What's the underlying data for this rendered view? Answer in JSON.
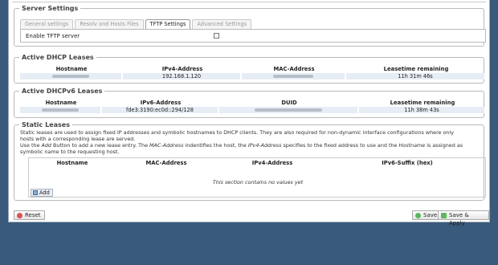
{
  "server_settings": {
    "legend": "Server Settings",
    "tabs": [
      "General settings",
      "Resolv and Hosts Files",
      "TFTP Settings",
      "Advanced Settings"
    ],
    "active_tab": "TFTP Settings",
    "enable_tftp_label": "Enable TFTP server",
    "enable_tftp_checked": false
  },
  "dhcp_leases": {
    "legend": "Active DHCP Leases",
    "headers": [
      "Hostname",
      "IPv4-Address",
      "MAC-Address",
      "Leasetime remaining"
    ],
    "row": {
      "ipv4": "192.168.1.120",
      "lease": "11h 31m 46s"
    }
  },
  "dhcpv6_leases": {
    "legend": "Active DHCPv6 Leases",
    "headers": [
      "Hostname",
      "IPv6-Address",
      "DUID",
      "Leasetime remaining"
    ],
    "row": {
      "ipv6": "fde3:3190:ec0d::294/128",
      "lease": "11h 38m 43s"
    }
  },
  "static_leases": {
    "legend": "Static Leases",
    "desc_line1": "Static leases are used to assign fixed IP addresses and symbolic hostnames to DHCP clients. They are also required for non-dynamic interface configurations where only",
    "desc_line2": "hosts with a corresponding lease are served.",
    "desc_p1": "Use the ",
    "desc_add": "Add",
    "desc_p2": " Button to add a new lease entry. The ",
    "desc_mac": "MAC-Address",
    "desc_p3": " indentifies the host, the ",
    "desc_ipv4": "IPv4-Address",
    "desc_p4": " specifies to the fixed address to use and the ",
    "desc_hostname": "Hostname",
    "desc_p5": " is assigned as",
    "desc_line4": "symbolic name to the requesting host.",
    "headers": [
      "Hostname",
      "MAC-Address",
      "IPv4-Address",
      "IPv6-Suffix (hex)"
    ],
    "empty_message": "This section contains no values yet",
    "add_label": "Add"
  },
  "footer": {
    "reset_label": "Reset",
    "save_label": "Save",
    "save_apply_label": "Save & Apply"
  },
  "colors": {
    "page_background": "#3a5a7c",
    "row_background": "#e6edf5",
    "reset_icon": "#d9534f",
    "save_icon": "#5cb85c"
  }
}
